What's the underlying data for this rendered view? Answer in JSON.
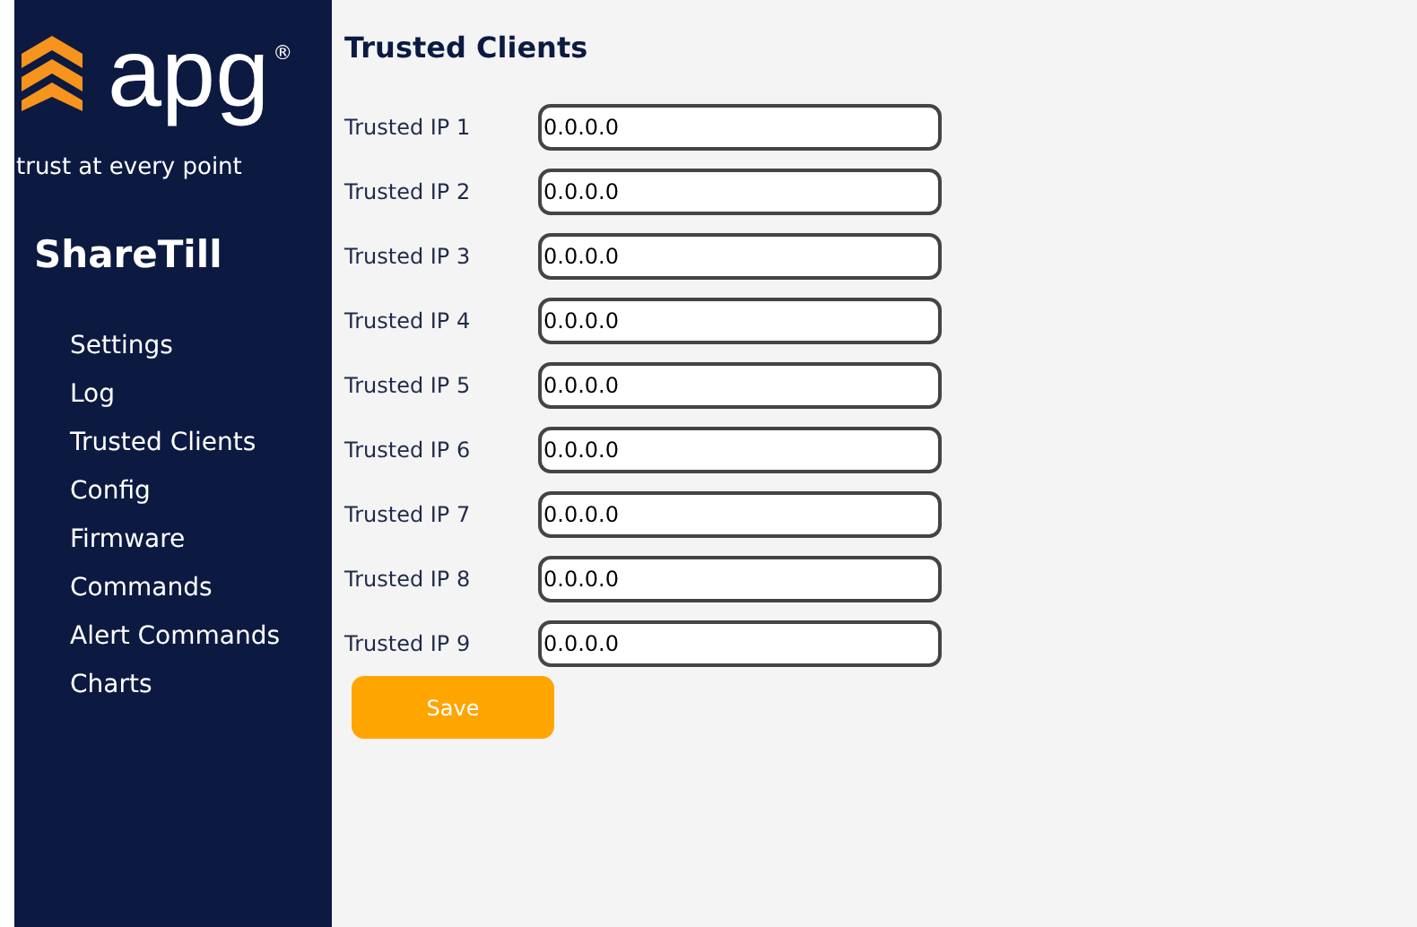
{
  "logo": {
    "wordmark": "apg",
    "registered": "®",
    "tagline": "trust at every point"
  },
  "sidebar": {
    "title": "ShareTill",
    "items": [
      {
        "label": "Settings"
      },
      {
        "label": "Log"
      },
      {
        "label": "Trusted Clients"
      },
      {
        "label": "Config"
      },
      {
        "label": "Firmware"
      },
      {
        "label": "Commands"
      },
      {
        "label": "Alert Commands"
      },
      {
        "label": "Charts"
      }
    ]
  },
  "page": {
    "title": "Trusted Clients",
    "fields": [
      {
        "label": "Trusted IP 1",
        "value": "0.0.0.0"
      },
      {
        "label": "Trusted IP 2",
        "value": "0.0.0.0"
      },
      {
        "label": "Trusted IP 3",
        "value": "0.0.0.0"
      },
      {
        "label": "Trusted IP 4",
        "value": "0.0.0.0"
      },
      {
        "label": "Trusted IP 5",
        "value": "0.0.0.0"
      },
      {
        "label": "Trusted IP 6",
        "value": "0.0.0.0"
      },
      {
        "label": "Trusted IP 7",
        "value": "0.0.0.0"
      },
      {
        "label": "Trusted IP 8",
        "value": "0.0.0.0"
      },
      {
        "label": "Trusted IP 9",
        "value": "0.0.0.0"
      }
    ],
    "save_button": "Save"
  }
}
